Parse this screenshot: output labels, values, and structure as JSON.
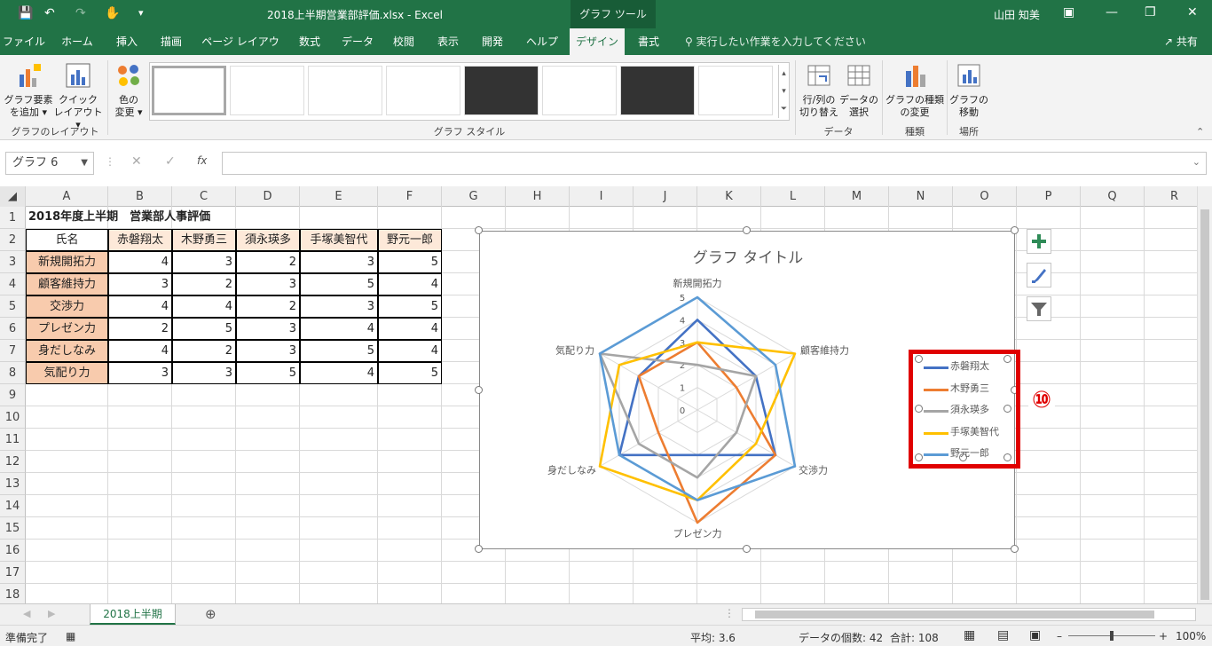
{
  "window": {
    "title": "2018上半期営業部評価.xlsx  -  Excel",
    "tool_context": "グラフ ツール",
    "user": "山田 知美",
    "accent": "#217346"
  },
  "tabs": [
    "ファイル",
    "ホーム",
    "挿入",
    "描画",
    "ページ レイアウト",
    "数式",
    "データ",
    "校閲",
    "表示",
    "開発",
    "ヘルプ",
    "デザイン",
    "書式"
  ],
  "active_tab": "デザイン",
  "tell_me": "実行したい作業を入力してください",
  "share": "共有",
  "ribbon": {
    "add_element": [
      "グラフ要素",
      "を追加"
    ],
    "quick_layout": [
      "クイック",
      "レイアウト"
    ],
    "change_colors": [
      "色の",
      "変更"
    ],
    "group_layouts": "グラフのレイアウト",
    "group_styles": "グラフ スタイル",
    "switch_row_col": [
      "行/列の",
      "切り替え"
    ],
    "select_data": [
      "データの",
      "選択"
    ],
    "group_data": "データ",
    "change_type": [
      "グラフの種類",
      "の変更"
    ],
    "group_type": "種類",
    "move_chart": [
      "グラフの",
      "移動"
    ],
    "group_location": "場所"
  },
  "name_box": "グラフ 6",
  "fx": "fx",
  "columns": [
    "A",
    "B",
    "C",
    "D",
    "E",
    "F",
    "G",
    "H",
    "I",
    "J",
    "K",
    "L",
    "M",
    "N",
    "O",
    "P",
    "Q",
    "R"
  ],
  "rows": [
    "1",
    "2",
    "3",
    "4",
    "5",
    "6",
    "7",
    "8",
    "9",
    "10",
    "11",
    "12",
    "13",
    "14",
    "15",
    "16",
    "17",
    "18"
  ],
  "sheet": {
    "title": "2018年度上半期　営業部人事評価",
    "header_label": "氏名",
    "people": [
      "赤磐翔太",
      "木野勇三",
      "須永瑛多",
      "手塚美智代",
      "野元一郎"
    ],
    "criteria": [
      "新規開拓力",
      "顧客維持力",
      "交渉力",
      "プレゼン力",
      "身だしなみ",
      "気配り力"
    ],
    "scores": [
      [
        4,
        3,
        2,
        3,
        5
      ],
      [
        3,
        2,
        3,
        5,
        4
      ],
      [
        4,
        4,
        2,
        3,
        5
      ],
      [
        2,
        5,
        3,
        4,
        4
      ],
      [
        4,
        2,
        3,
        5,
        4
      ],
      [
        3,
        3,
        5,
        4,
        5
      ]
    ]
  },
  "chart_data": {
    "type": "radar",
    "title": "グラフ タイトル",
    "axes": [
      "新規開拓力",
      "顧客維持力",
      "交渉力",
      "プレゼン力",
      "身だしなみ",
      "気配り力"
    ],
    "ticks": [
      "0",
      "1",
      "2",
      "3",
      "4",
      "5"
    ],
    "range": [
      0,
      5
    ],
    "legend_position": "right",
    "series": [
      {
        "name": "赤磐翔太",
        "color": "#4472c4",
        "values": [
          4,
          3,
          4,
          2,
          4,
          3
        ]
      },
      {
        "name": "木野勇三",
        "color": "#ed7d31",
        "values": [
          3,
          2,
          4,
          5,
          2,
          3
        ]
      },
      {
        "name": "須永瑛多",
        "color": "#a5a5a5",
        "values": [
          2,
          3,
          2,
          3,
          3,
          5
        ]
      },
      {
        "name": "手塚美智代",
        "color": "#ffc000",
        "values": [
          3,
          5,
          3,
          4,
          5,
          4
        ]
      },
      {
        "name": "野元一郎",
        "color": "#5b9bd5",
        "values": [
          5,
          4,
          5,
          4,
          4,
          5
        ]
      }
    ]
  },
  "annotation": "⑩",
  "sheet_tab": "2018上半期",
  "status": {
    "ready": "準備完了",
    "average": "平均: 3.6",
    "count": "データの個数: 42",
    "sum": "合計: 108",
    "zoom": "100%"
  }
}
